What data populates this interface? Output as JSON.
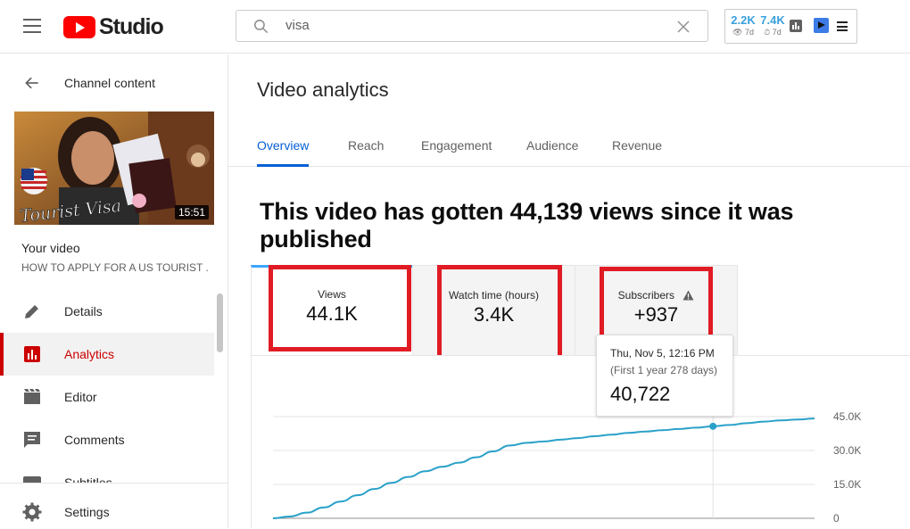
{
  "header": {
    "logo_text": "Studio",
    "search": {
      "value": "visa"
    },
    "extension": {
      "stat1": {
        "value": "2.2K",
        "period": "7d"
      },
      "stat2": {
        "value": "7.4K",
        "period": "7d"
      }
    }
  },
  "sidebar": {
    "back_label": "Channel content",
    "thumbnail": {
      "duration": "15:51",
      "overlay_text": "Tourist Visa"
    },
    "your_video_label": "Your video",
    "video_title": "HOW TO APPLY FOR A US TOURIST ...",
    "items": [
      {
        "label": "Details",
        "icon": "pencil-icon"
      },
      {
        "label": "Analytics",
        "icon": "analytics-icon",
        "active": true
      },
      {
        "label": "Editor",
        "icon": "film-icon"
      },
      {
        "label": "Comments",
        "icon": "comment-icon"
      },
      {
        "label": "Subtitles",
        "icon": "subtitles-icon"
      }
    ],
    "settings_label": "Settings"
  },
  "main": {
    "title": "Video analytics",
    "tabs": [
      "Overview",
      "Reach",
      "Engagement",
      "Audience",
      "Revenue"
    ],
    "active_tab": "Overview",
    "headline": "This video has gotten 44,139 views since it was published",
    "metrics": [
      {
        "label": "Views",
        "value": "44.1K"
      },
      {
        "label": "Watch time (hours)",
        "value": "3.4K"
      },
      {
        "label": "Subscribers",
        "value": "+937",
        "warning": true
      }
    ],
    "tooltip": {
      "date": "Thu, Nov 5, 12:16 PM",
      "range": "(First 1 year 278 days)",
      "value": "40,722"
    }
  },
  "colors": {
    "accent": "#065fd4",
    "brand_red": "#ff0000",
    "highlight_box": "#e01b24",
    "line": "#2aa1c9"
  },
  "chart_data": {
    "type": "line",
    "y_ticks": [
      "45.0K",
      "30.0K",
      "15.0K",
      "0"
    ],
    "ylim": [
      0,
      45000
    ],
    "series": [
      {
        "values": [
          0,
          800,
          2500,
          4800,
          7400,
          10200,
          13000,
          15700,
          18300,
          20800,
          22800,
          24600,
          27000,
          29600,
          32200,
          33400,
          34000,
          34800,
          35500,
          36300,
          37000,
          37800,
          38400,
          39000,
          39500,
          40100,
          40722,
          41300,
          42100,
          42800,
          43300,
          43700,
          44139
        ]
      }
    ],
    "highlight_index": 26
  }
}
